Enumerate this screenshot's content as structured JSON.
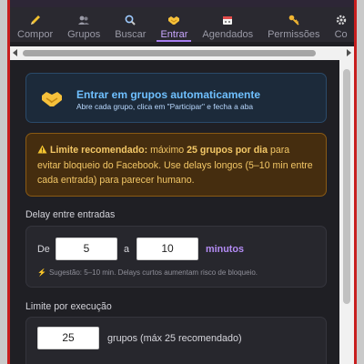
{
  "tabs": [
    {
      "label": "Compor",
      "icon": "pencil-icon",
      "active": false
    },
    {
      "label": "Grupos",
      "icon": "people-icon",
      "active": false
    },
    {
      "label": "Buscar",
      "icon": "search-icon",
      "active": false
    },
    {
      "label": "Entrar",
      "icon": "handshake-icon",
      "active": true
    },
    {
      "label": "Agendados",
      "icon": "calendar-icon",
      "active": false
    },
    {
      "label": "Permissões",
      "icon": "key-icon",
      "active": false
    },
    {
      "label": "Co",
      "icon": "gear-icon",
      "active": false
    }
  ],
  "banner": {
    "title": "Entrar em grupos automaticamente",
    "subtitle": "Abre cada grupo, clica em \"Participar\" e fecha a aba"
  },
  "warning": {
    "strong_prefix": "Limite recomendado:",
    "text_1": " máximo ",
    "strong_count": "25 grupos por dia",
    "text_2": " para evitar bloqueio do Facebook. Use delays longos (5–10 min entre cada entrada) para parecer humano."
  },
  "delay": {
    "section_label": "Delay entre entradas",
    "from_label": "De",
    "from_value": "5",
    "to_label": "a",
    "to_value": "10",
    "unit": "minutos",
    "hint": "Sugestão: 5–10 min. Delays curtos aumentam risco de bloqueio."
  },
  "limit": {
    "section_label": "Limite por execução",
    "value": "25",
    "after_text": "grupos (máx 25 recomendado)"
  },
  "colors": {
    "accent": "#a57cf0",
    "info": "#6fc0ff",
    "warning": "#f3c766",
    "frame_border": "#c81e1e"
  }
}
